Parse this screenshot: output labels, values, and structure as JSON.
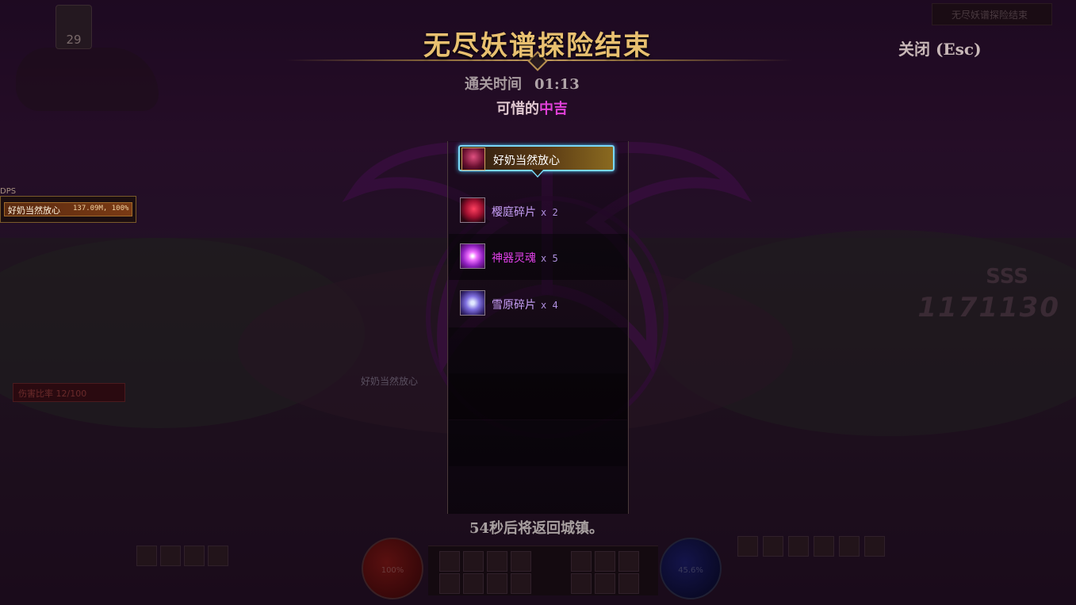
{
  "title": "无尽妖谱探险结束",
  "close_label": "关闭 (Esc)",
  "clear_time_label": "通关时间",
  "clear_time_value": "01:13",
  "fortune_prefix": "可惜的",
  "fortune_rank": "中吉",
  "player_name": "好奶当然放心",
  "rewards": [
    {
      "name": "樱庭碎片",
      "qty": "x 2",
      "icon": "sakura-fragment-icon"
    },
    {
      "name": "神器灵魂",
      "qty": "x 5",
      "icon": "artifact-soul-icon"
    },
    {
      "name": "雪原碎片",
      "qty": "x 4",
      "icon": "snowfield-fragment-icon"
    }
  ],
  "return_message": "54秒后将返回城镇。",
  "hud": {
    "level": "29",
    "dps_label": "DPS",
    "dps_name": "好奶当然放心",
    "dps_value": "137.09M, 100%",
    "combo": "1171130",
    "combo_rank": "SSS",
    "kill_text": "伤害比率 12/100",
    "hp_text": "100%",
    "mp_text": "45.6%"
  },
  "colors": {
    "title": "#e8c070",
    "fortune_rank": "#e040d8",
    "item_rare": "#c8a0f8",
    "item_epic": "#e040e8",
    "card_border": "#7ad8f8"
  }
}
